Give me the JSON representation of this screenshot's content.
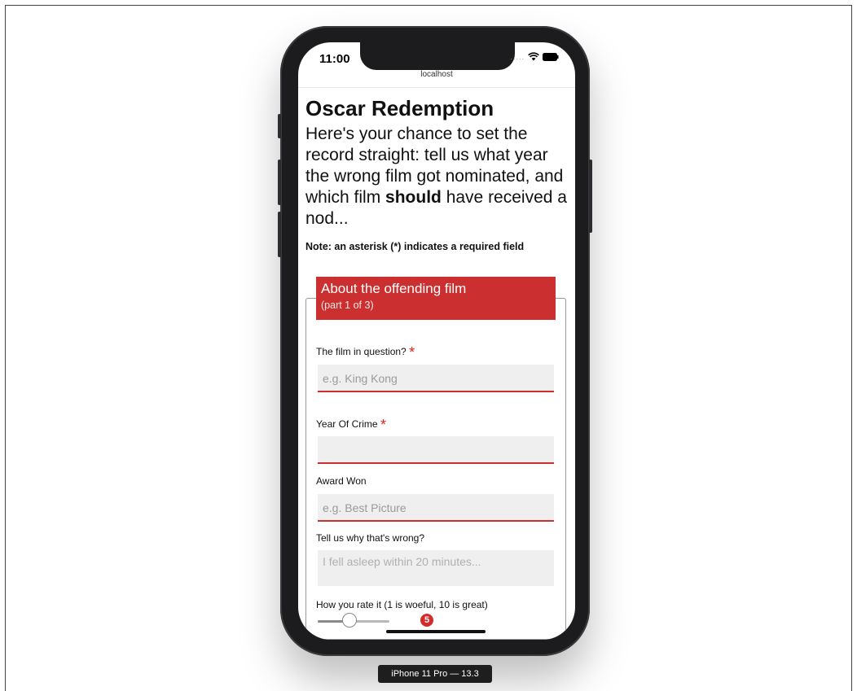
{
  "device": {
    "label": "iPhone 11 Pro — 13.3"
  },
  "status_bar": {
    "time": "11:00",
    "signal_dots": "....."
  },
  "browser": {
    "url": "localhost"
  },
  "page": {
    "title": "Oscar Redemption",
    "intro_before_bold": "Here's your chance to set the record straight: tell us what year the wrong film got nominated, and which film ",
    "intro_bold": "should",
    "intro_after_bold": " have received a nod...",
    "note": "Note: an asterisk (*) indicates a required field"
  },
  "form": {
    "legend_title": "About the offending film",
    "legend_subtitle": "(part 1 of 3)",
    "required_marker": "*",
    "film_label": "The film in question?",
    "film_placeholder": "e.g. King Kong",
    "year_label": "Year Of Crime",
    "year_value": "",
    "award_label": "Award Won",
    "award_placeholder": "e.g. Best Picture",
    "why_label": "Tell us why that's wrong?",
    "why_placeholder": "I fell asleep within 20 minutes...",
    "rating_label": "How you rate it (1 is woeful, 10 is great)",
    "rating_value": "5",
    "rating_fraction": 0.44
  },
  "colors": {
    "accent": "#cc2f2f",
    "required": "#e02020",
    "field_bg": "#efefef"
  }
}
